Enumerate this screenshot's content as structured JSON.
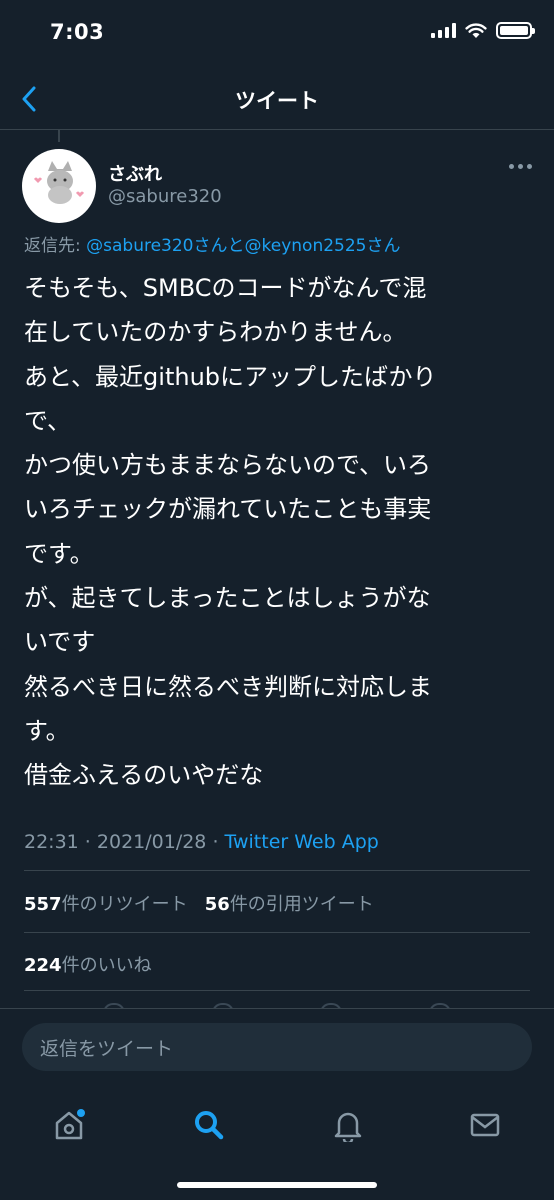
{
  "status_bar": {
    "time": "7:03"
  },
  "header": {
    "title": "ツイート"
  },
  "tweet": {
    "author_name": "さぶれ",
    "author_handle": "@sabure320",
    "reply_prefix": "返信先: ",
    "reply_mention_1": "@sabure320さんと",
    "reply_mention_2": "@keynon2525さん",
    "text_lines": [
      "そもそも、SMBCのコードがなんで混",
      "在していたのかすらわかりません。",
      "あと、最近githubにアップしたばかり",
      "で、",
      "かつ使い方もままならないので、いろ",
      "いろチェックが漏れていたことも事実",
      "です。",
      "が、起きてしまったことはしょうがな",
      "いです",
      "然るべき日に然るべき判断に対応しま",
      "す。",
      "借金ふえるのいやだな"
    ],
    "time": "22:31",
    "date": "2021/01/28",
    "separator": " · ",
    "source_app": "Twitter Web App",
    "retweet_count": "557",
    "retweet_label": "件のリツイート",
    "quote_count": "56",
    "quote_label": "件の引用ツイート",
    "like_count": "224",
    "like_label": "件のいいね"
  },
  "reply_bar": {
    "placeholder": "返信をツイート"
  },
  "tabs": [
    {
      "name": "home",
      "icon": "home-icon"
    },
    {
      "name": "search",
      "icon": "search-icon"
    },
    {
      "name": "notifications",
      "icon": "bell-icon"
    },
    {
      "name": "messages",
      "icon": "mail-icon"
    }
  ],
  "colors": {
    "background": "#15202b",
    "accent": "#1da1f2",
    "secondary_text": "#8899a6",
    "divider": "#38444d"
  }
}
